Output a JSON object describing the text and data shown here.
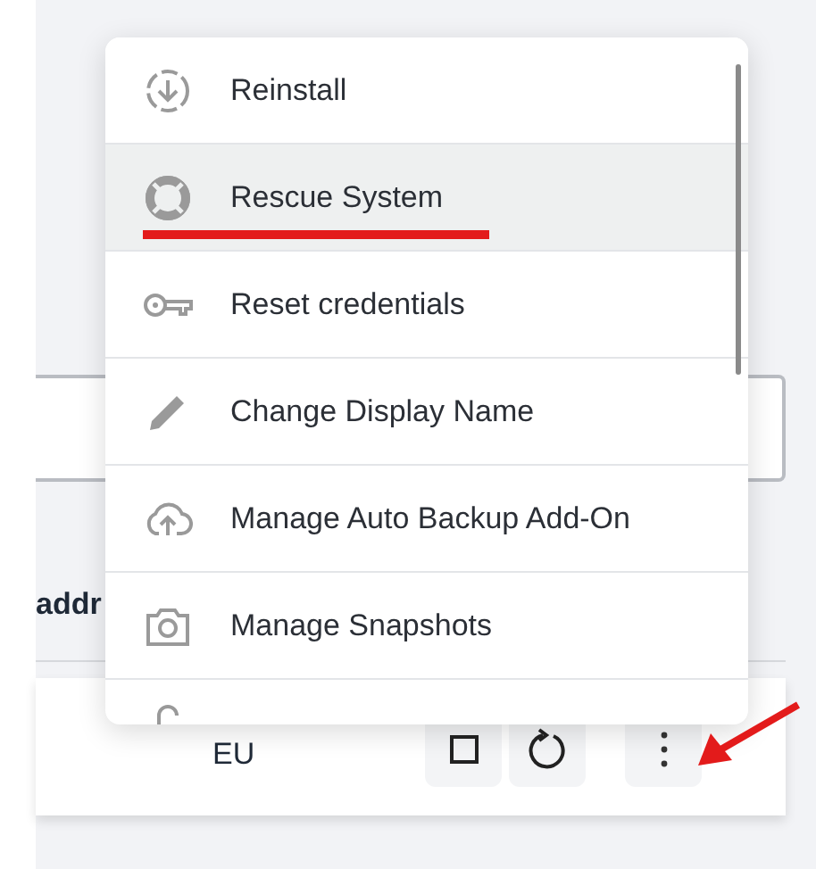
{
  "menu": {
    "items": [
      {
        "label": "Reinstall",
        "selected": false
      },
      {
        "label": "Rescue System",
        "selected": true
      },
      {
        "label": "Reset credentials",
        "selected": false
      },
      {
        "label": "Change Display Name",
        "selected": false
      },
      {
        "label": "Manage Auto Backup Add-On",
        "selected": false
      },
      {
        "label": "Manage Snapshots",
        "selected": false
      }
    ]
  },
  "section_heading": "addr",
  "server_row": {
    "region": "EU"
  }
}
